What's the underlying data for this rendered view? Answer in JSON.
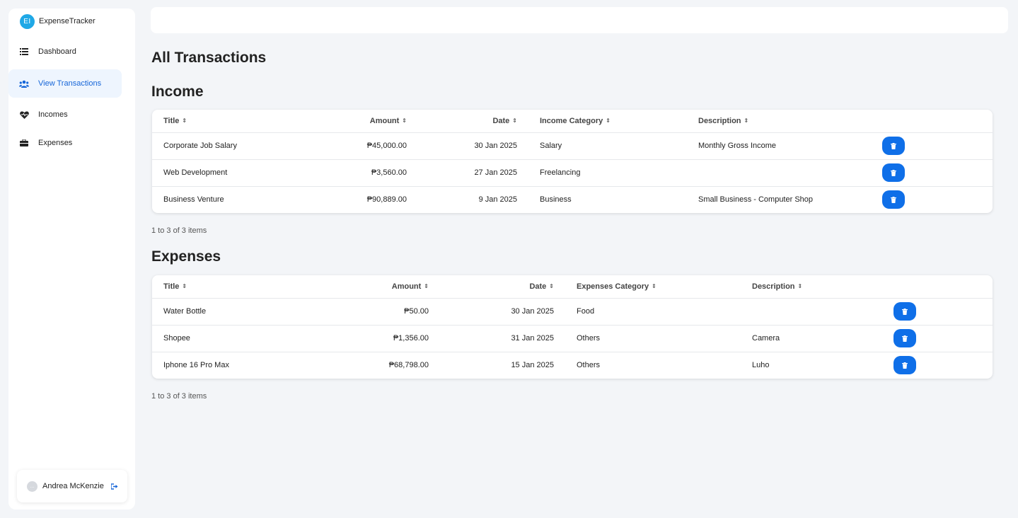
{
  "brand": {
    "logo_text": "EI",
    "name": "ExpenseTracker"
  },
  "nav": {
    "items": [
      {
        "label": "Dashboard",
        "icon": "list-icon"
      },
      {
        "label": "View Transactions",
        "icon": "users-icon",
        "active": true
      },
      {
        "label": "Incomes",
        "icon": "heartbeat-icon"
      },
      {
        "label": "Expenses",
        "icon": "wallet-icon"
      }
    ]
  },
  "user": {
    "initials": "...",
    "name": "Andrea McKenzie"
  },
  "page": {
    "title": "All Transactions"
  },
  "colors": {
    "accent": "#0f6fe8",
    "active_bg": "#eef5fe",
    "active_text": "#1565d8"
  },
  "income": {
    "title": "Income",
    "headers": {
      "title": "Title",
      "amount": "Amount",
      "date": "Date",
      "category": "Income Category",
      "description": "Description"
    },
    "rows": [
      {
        "title": "Corporate Job Salary",
        "amount": "₱45,000.00",
        "date": "30 Jan 2025",
        "category": "Salary",
        "description": "Monthly Gross Income"
      },
      {
        "title": "Web Development",
        "amount": "₱3,560.00",
        "date": "27 Jan 2025",
        "category": "Freelancing",
        "description": ""
      },
      {
        "title": "Business Venture",
        "amount": "₱90,889.00",
        "date": "9 Jan 2025",
        "category": "Business",
        "description": "Small Business - Computer Shop"
      }
    ],
    "pager": "1 to 3 of 3 items"
  },
  "expenses": {
    "title": "Expenses",
    "headers": {
      "title": "Title",
      "amount": "Amount",
      "date": "Date",
      "category": "Expenses Category",
      "description": "Description"
    },
    "rows": [
      {
        "title": "Water Bottle",
        "amount": "₱50.00",
        "date": "30 Jan 2025",
        "category": "Food",
        "description": ""
      },
      {
        "title": "Shopee",
        "amount": "₱1,356.00",
        "date": "31 Jan 2025",
        "category": "Others",
        "description": "Camera"
      },
      {
        "title": "Iphone 16 Pro Max",
        "amount": "₱68,798.00",
        "date": "15 Jan 2025",
        "category": "Others",
        "description": "Luho"
      }
    ],
    "pager": "1 to 3 of 3 items"
  }
}
